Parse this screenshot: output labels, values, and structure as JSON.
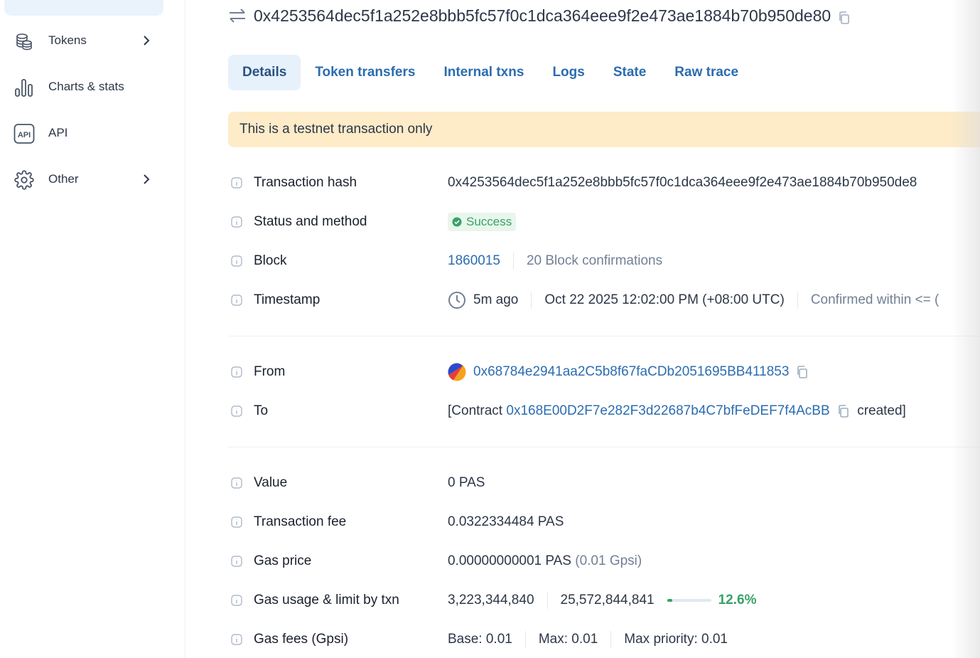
{
  "sidebar": {
    "items": [
      {
        "label": "Tokens",
        "icon": "tokens-icon",
        "has_chevron": true
      },
      {
        "label": "Charts & stats",
        "icon": "charts-icon",
        "has_chevron": false
      },
      {
        "label": "API",
        "icon": "api-icon",
        "has_chevron": false
      },
      {
        "label": "Other",
        "icon": "gear-icon",
        "has_chevron": true
      }
    ]
  },
  "header": {
    "tx_hash": "0x4253564dec5f1a252e8bbb5fc57f0c1dca364eee9f2e473ae1884b70b950de80"
  },
  "tabs": [
    "Details",
    "Token transfers",
    "Internal txns",
    "Logs",
    "State",
    "Raw trace"
  ],
  "active_tab": "Details",
  "banner": "This is a testnet transaction only",
  "details": {
    "tx_hash_label": "Transaction hash",
    "tx_hash_value": "0x4253564dec5f1a252e8bbb5fc57f0c1dca364eee9f2e473ae1884b70b950de8",
    "status_label": "Status and method",
    "status_value": "Success",
    "block_label": "Block",
    "block_value": "1860015",
    "block_confirmations": "20 Block confirmations",
    "timestamp_label": "Timestamp",
    "timestamp_ago": "5m ago",
    "timestamp_full": "Oct 22 2025 12:02:00 PM (+08:00 UTC)",
    "timestamp_confirmed": "Confirmed within <= (",
    "from_label": "From",
    "from_value": "0x68784e2941aa2C5b8f67faCDb2051695BB411853",
    "to_label": "To",
    "to_prefix": "[Contract",
    "to_value": "0x168E00D2F7e282F3d22687b4C7bfFeDEF7f4AcBB",
    "to_suffix": "created]",
    "value_label": "Value",
    "value_value": "0 PAS",
    "fee_label": "Transaction fee",
    "fee_value": "0.0322334484 PAS",
    "gas_price_label": "Gas price",
    "gas_price_value": "0.00000000001 PAS",
    "gas_price_gpsi": "(0.01 Gpsi)",
    "gas_usage_label": "Gas usage & limit by txn",
    "gas_used": "3,223,344,840",
    "gas_limit": "25,572,844,841",
    "gas_pct": "12.6%",
    "gas_pct_fraction": 0.126,
    "gas_fees_label": "Gas fees (Gpsi)",
    "gas_base": "Base: 0.01",
    "gas_max": "Max: 0.01",
    "gas_max_priority": "Max priority: 0.01"
  },
  "colors": {
    "link": "#2b6cb0",
    "success": "#38a169",
    "banner_bg": "#feebc8",
    "active_tab_bg": "#e6f1fb"
  }
}
